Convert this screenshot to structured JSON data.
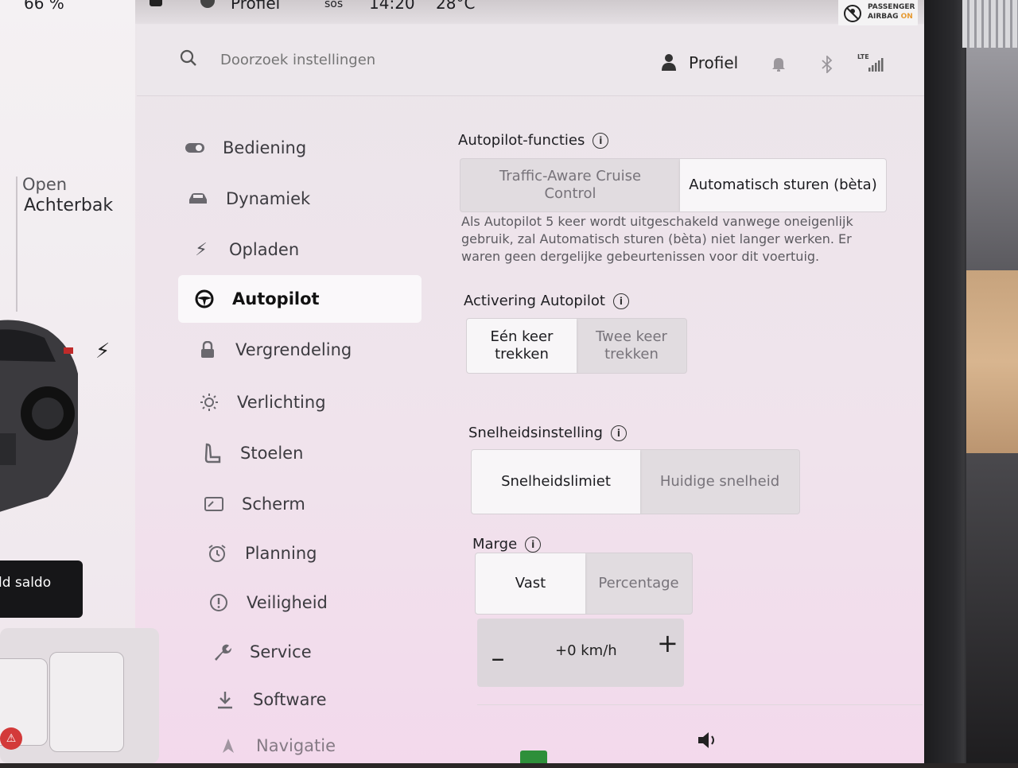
{
  "status_bar": {
    "battery": "66 %",
    "profile": "Profiel",
    "sos": "sos",
    "time": "14:20",
    "temperature": "28°C",
    "passenger_airbag": {
      "line1": "PASSENGER",
      "line2_prefix": "AIRBAG",
      "line2_state": "ON"
    }
  },
  "car_panel": {
    "trunk_line1": "Open",
    "trunk_line2": "Achterbak",
    "balance_label": "ld saldo"
  },
  "header": {
    "search_placeholder": "Doorzoek instellingen",
    "profile_label": "Profiel",
    "lte_label": "LTE"
  },
  "nav": {
    "items": [
      {
        "label": "Bediening",
        "icon": "toggle-icon"
      },
      {
        "label": "Dynamiek",
        "icon": "car-icon"
      },
      {
        "label": "Opladen",
        "icon": "bolt-icon"
      },
      {
        "label": "Autopilot",
        "icon": "steering-wheel-icon",
        "active": true
      },
      {
        "label": "Vergrendeling",
        "icon": "lock-icon"
      },
      {
        "label": "Verlichting",
        "icon": "sun-icon"
      },
      {
        "label": "Stoelen",
        "icon": "seat-icon"
      },
      {
        "label": "Scherm",
        "icon": "display-icon"
      },
      {
        "label": "Planning",
        "icon": "alarm-clock-icon"
      },
      {
        "label": "Veiligheid",
        "icon": "alert-circle-icon"
      },
      {
        "label": "Service",
        "icon": "wrench-icon"
      },
      {
        "label": "Software",
        "icon": "download-icon"
      },
      {
        "label": "Navigatie",
        "icon": "navigation-icon"
      }
    ]
  },
  "autopilot": {
    "features_title": "Autopilot-functies",
    "features_options": [
      "Traffic-Aware Cruise Control",
      "Automatisch sturen (bèta)"
    ],
    "features_selected": 1,
    "description": "Als Autopilot 5 keer wordt uitgeschakeld vanwege oneigenlijk gebruik, zal Automatisch sturen (bèta) niet langer werken. Er waren geen dergelijke gebeurtenissen voor dit voertuig.",
    "activation_title": "Activering Autopilot",
    "activation_options": [
      "Eén keer trekken",
      "Twee keer trekken"
    ],
    "activation_selected": 0,
    "speed_title": "Snelheidsinstelling",
    "speed_options": [
      "Snelheidslimiet",
      "Huidige snelheid"
    ],
    "speed_selected": 0,
    "margin_title": "Marge",
    "margin_options": [
      "Vast",
      "Percentage"
    ],
    "margin_selected": 0,
    "offset_value": "+0 km/h",
    "minus_symbol": "–",
    "plus_symbol": "+"
  }
}
